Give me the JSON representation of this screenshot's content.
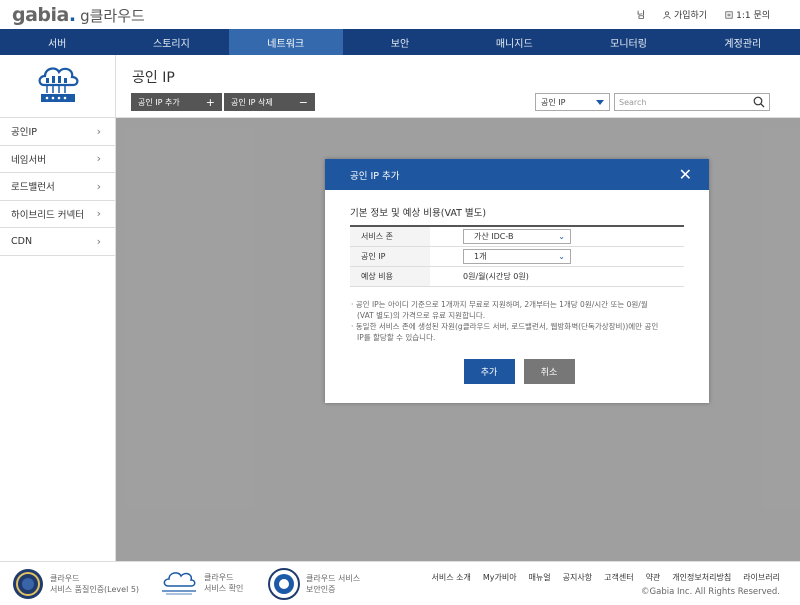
{
  "brand": {
    "logo_main": "gabia",
    "logo_dot": ".",
    "logo_sub": "g클라우드"
  },
  "user_links": {
    "user_suffix": "님",
    "join": "가입하기",
    "inquiry": "1:1 문의"
  },
  "nav": {
    "items": [
      {
        "label": "서버"
      },
      {
        "label": "스토리지"
      },
      {
        "label": "네트워크"
      },
      {
        "label": "보안"
      },
      {
        "label": "매니지드"
      },
      {
        "label": "모니터링"
      },
      {
        "label": "계정관리"
      }
    ],
    "active_index": 2
  },
  "sidebar": {
    "items": [
      {
        "label": "공인IP"
      },
      {
        "label": "네임서버"
      },
      {
        "label": "로드밸런서"
      },
      {
        "label": "하이브리드 커넥터"
      },
      {
        "label": "CDN"
      }
    ]
  },
  "main": {
    "title": "공인 IP",
    "add_button": "공인 IP 추가",
    "delete_button": "공인 IP 삭제",
    "filter_select": "공인 IP",
    "search_placeholder": "Search"
  },
  "modal": {
    "title": "공인 IP 추가",
    "section_title": "기본 정보 및 예상 비용(VAT 별도)",
    "rows": [
      {
        "label": "서비스 존",
        "value": "가산 IDC-B"
      },
      {
        "label": "공인 IP",
        "value": "1개"
      },
      {
        "label": "예상 비용",
        "value": "0원/월(시간당 0원)"
      }
    ],
    "notes": [
      "· 공인 IP는 아이디 기준으로 1개까지 무료로 지원하며, 2개부터는 1개당 0원/시간 또는 0원/월",
      "  (VAT 별도)의 가격으로 유료 지원합니다.",
      "· 동일한 서비스 존에 생성된 자원(g클라우드 서버, 로드밸런서, 웹방화벽(단독가상장비))에만 공인",
      "  IP를 할당할 수 있습니다."
    ],
    "confirm_label": "추가",
    "cancel_label": "취소"
  },
  "footer": {
    "certs": [
      {
        "line1": "클라우드",
        "line2": "서비스 품질인증(Level 5)"
      },
      {
        "line1": "클라우드",
        "line2": "서비스 확인"
      },
      {
        "line1": "클라우드 서비스",
        "line2": "보안인증"
      }
    ],
    "links": [
      "서비스 소개",
      "My가비아",
      "매뉴얼",
      "공지사항",
      "고객센터",
      "약관",
      "개인정보처리방침",
      "라이브러리"
    ],
    "copyright": "©Gabia Inc. All Rights Reserved."
  },
  "colors": {
    "nav_bg": "#163e7c",
    "nav_active": "#3569ad",
    "primary": "#1e56a0"
  }
}
